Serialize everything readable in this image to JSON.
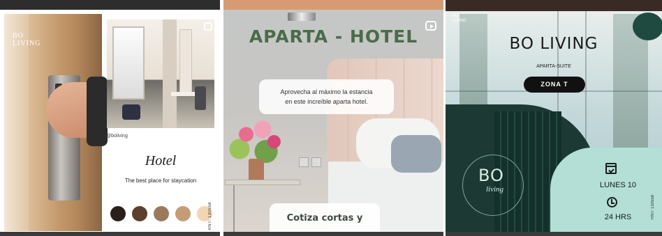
{
  "tiles": {
    "t1": {
      "brand_line1": "BO",
      "brand_line2": "LIVING",
      "handle": "@boliving",
      "title": "Hotel",
      "tagline": "The best place for staycation",
      "palette": [
        "#2a1f1b",
        "#5c3f2c",
        "#9b7a5c",
        "#c59c76",
        "#f2d5b2"
      ],
      "rnt": "RNT: 130558"
    },
    "t2": {
      "title": "APARTA - HOTEL",
      "bubble_line1": "Aprovecha al máximo la estancia",
      "bubble_line2": "en este increíble aparta hotel.",
      "cta": "Cotiza cortas y"
    },
    "t3": {
      "corner_brand_line1": "BO",
      "corner_brand_line2": "LIVING",
      "brand": "BO LIVING",
      "subtitle": "APARTA-SUITE",
      "zone_button": "ZONA T",
      "logo_main": "BO",
      "logo_sub": "living",
      "date": "LUNES 10",
      "hours": "24 HRS",
      "rnt": "RNT: 130558"
    }
  }
}
